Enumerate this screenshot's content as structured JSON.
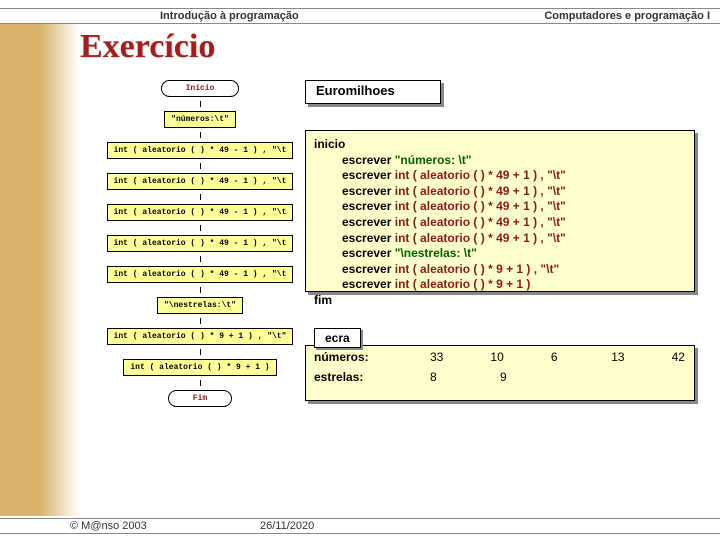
{
  "header": {
    "left": "Introdução à programação",
    "right": "Computadores e programação I"
  },
  "title": "Exercício",
  "flowchart": {
    "start": "Início",
    "s1": "\"números:\\t\"",
    "s2": "int ( aleatorio ( ) * 49 - 1 ) , \"\\t",
    "s3": "int ( aleatorio ( ) * 49 - 1 ) , \"\\t",
    "s4": "int ( aleatorio ( ) * 49 - 1 ) , \"\\t",
    "s5": "int ( aleatorio ( ) * 49 - 1 ) , \"\\t",
    "s6": "int ( aleatorio ( ) * 49 - 1 ) , \"\\t",
    "s7": "\"\\nestrelas:\\t\"",
    "s8": "int ( aleatorio ( ) * 9 + 1 ) , \"\\t\"",
    "s9": "int ( aleatorio ( ) * 9 + 1 )",
    "end": "Fim"
  },
  "code": {
    "panelTitle": "Euromilhoes",
    "kw_inicio": "inicio",
    "kw_fim": "fim",
    "lines": [
      {
        "cmd": "escrever",
        "text": "\"números: \\t\""
      },
      {
        "cmd": "escrever",
        "call": "int ( aleatorio ( ) * 49 + 1 ) , \"\\t\""
      },
      {
        "cmd": "escrever",
        "call": "int ( aleatorio ( ) * 49 + 1 ) , \"\\t\""
      },
      {
        "cmd": "escrever",
        "call": "int ( aleatorio ( ) * 49 + 1 ) , \"\\t\""
      },
      {
        "cmd": "escrever",
        "call": "int ( aleatorio ( ) * 49 + 1 ) , \"\\t\""
      },
      {
        "cmd": "escrever",
        "call": "int ( aleatorio ( ) * 49 + 1 ) , \"\\t\""
      },
      {
        "cmd": "escrever",
        "text": "\"\\nestrelas: \\t\""
      },
      {
        "cmd": "escrever",
        "call": "int ( aleatorio ( ) * 9 + 1 ) , \"\\t\""
      },
      {
        "cmd": "escrever",
        "call": "int ( aleatorio ( ) * 9 + 1 )"
      }
    ]
  },
  "output": {
    "panelTitle": "ecra",
    "row1": {
      "label": "números:",
      "v1": "33",
      "v2": "10",
      "v3": "6",
      "v4": "13",
      "v5": "42"
    },
    "row2": {
      "label": "estrelas:",
      "v1": "8",
      "v2": "9"
    }
  },
  "footer": {
    "left": "© M@nso 2003",
    "center": "26/11/2020"
  }
}
